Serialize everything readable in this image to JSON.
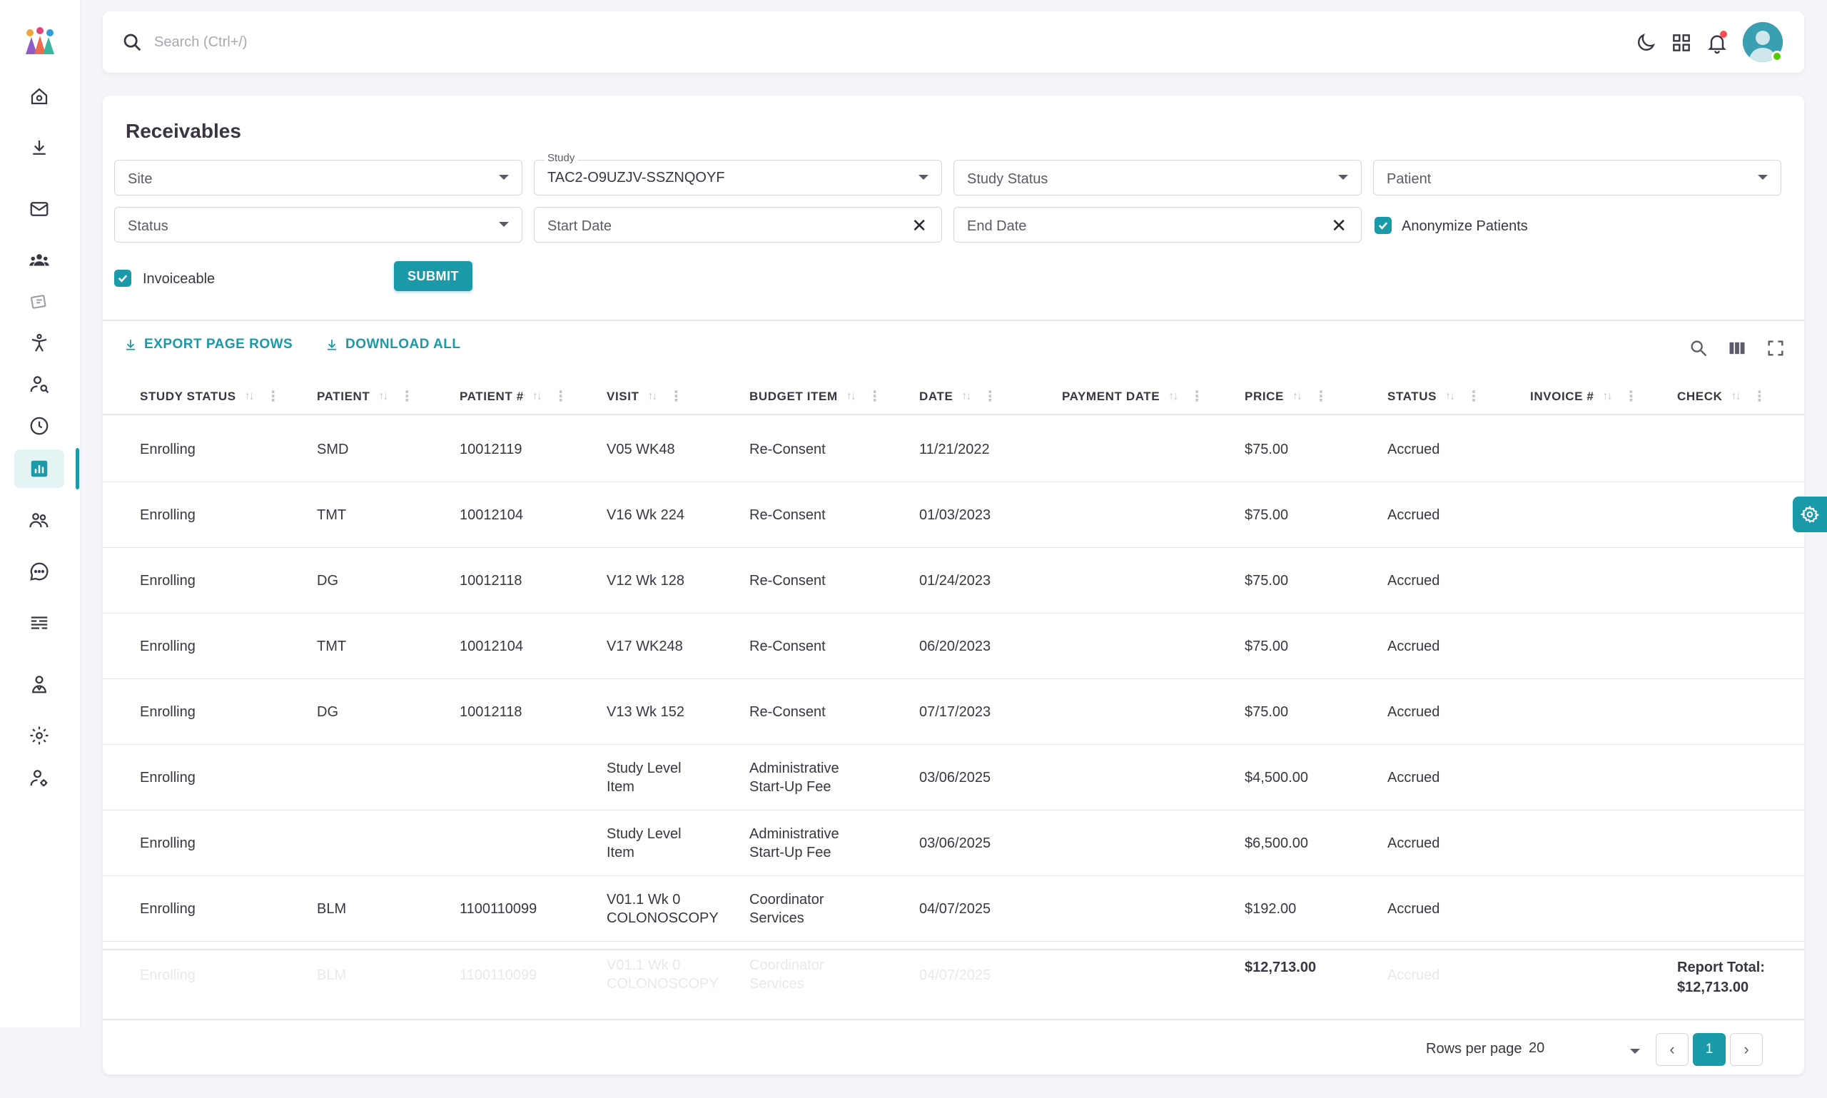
{
  "search": {
    "placeholder": "Search (Ctrl+/)"
  },
  "page": {
    "title": "Receivables"
  },
  "filters": {
    "site": {
      "placeholder": "Site"
    },
    "study": {
      "label": "Study",
      "value": "TAC2-O9UZJV-SSZNQOYF"
    },
    "study_status": {
      "placeholder": "Study Status"
    },
    "patient": {
      "placeholder": "Patient"
    },
    "status": {
      "placeholder": "Status"
    },
    "start_date": {
      "placeholder": "Start Date"
    },
    "end_date": {
      "placeholder": "End Date"
    },
    "anonymize": {
      "label": "Anonymize Patients",
      "checked": true
    },
    "invoiceable": {
      "label": "Invoiceable",
      "checked": true
    },
    "submit_label": "SUBMIT"
  },
  "toolbar": {
    "export_label": "EXPORT PAGE ROWS",
    "download_label": "DOWNLOAD ALL"
  },
  "table": {
    "columns": [
      "STUDY STATUS",
      "PATIENT",
      "PATIENT #",
      "VISIT",
      "BUDGET ITEM",
      "DATE",
      "PAYMENT DATE",
      "PRICE",
      "STATUS",
      "INVOICE #",
      "CHECK"
    ],
    "rows": [
      {
        "study_status": "Enrolling",
        "patient": "SMD",
        "patient_no": "10012119",
        "visit": [
          "V05 WK48"
        ],
        "budget_item": [
          "Re-Consent"
        ],
        "date": "11/21/2022",
        "payment_date": "",
        "price": "$75.00",
        "status": "Accrued",
        "invoice": "",
        "check": ""
      },
      {
        "study_status": "Enrolling",
        "patient": "TMT",
        "patient_no": "10012104",
        "visit": [
          "V16 Wk 224"
        ],
        "budget_item": [
          "Re-Consent"
        ],
        "date": "01/03/2023",
        "payment_date": "",
        "price": "$75.00",
        "status": "Accrued",
        "invoice": "",
        "check": ""
      },
      {
        "study_status": "Enrolling",
        "patient": "DG",
        "patient_no": "10012118",
        "visit": [
          "V12 Wk 128"
        ],
        "budget_item": [
          "Re-Consent"
        ],
        "date": "01/24/2023",
        "payment_date": "",
        "price": "$75.00",
        "status": "Accrued",
        "invoice": "",
        "check": ""
      },
      {
        "study_status": "Enrolling",
        "patient": "TMT",
        "patient_no": "10012104",
        "visit": [
          "V17 WK248"
        ],
        "budget_item": [
          "Re-Consent"
        ],
        "date": "06/20/2023",
        "payment_date": "",
        "price": "$75.00",
        "status": "Accrued",
        "invoice": "",
        "check": ""
      },
      {
        "study_status": "Enrolling",
        "patient": "DG",
        "patient_no": "10012118",
        "visit": [
          "V13 Wk 152"
        ],
        "budget_item": [
          "Re-Consent"
        ],
        "date": "07/17/2023",
        "payment_date": "",
        "price": "$75.00",
        "status": "Accrued",
        "invoice": "",
        "check": ""
      },
      {
        "study_status": "Enrolling",
        "patient": "",
        "patient_no": "",
        "visit": [
          "Study Level",
          "Item"
        ],
        "budget_item": [
          "Administrative",
          "Start-Up Fee"
        ],
        "date": "03/06/2025",
        "payment_date": "",
        "price": "$4,500.00",
        "status": "Accrued",
        "invoice": "",
        "check": ""
      },
      {
        "study_status": "Enrolling",
        "patient": "",
        "patient_no": "",
        "visit": [
          "Study Level",
          "Item"
        ],
        "budget_item": [
          "Administrative",
          "Start-Up Fee"
        ],
        "date": "03/06/2025",
        "payment_date": "",
        "price": "$6,500.00",
        "status": "Accrued",
        "invoice": "",
        "check": ""
      },
      {
        "study_status": "Enrolling",
        "patient": "BLM",
        "patient_no": "1100110099",
        "visit": [
          "V01.1 Wk 0",
          "COLONOSCOPY"
        ],
        "budget_item": [
          "Coordinator",
          "Services"
        ],
        "date": "04/07/2025",
        "payment_date": "",
        "price": "$192.00",
        "status": "Accrued",
        "invoice": "",
        "check": ""
      }
    ],
    "totals": {
      "price_total": "$12,713.00",
      "report_total_label": "Report Total:",
      "report_total_value": "$12,713.00"
    }
  },
  "pagination": {
    "rows_per_page_label": "Rows per page",
    "rows_per_page_value": "20",
    "current_page": "1"
  },
  "colors": {
    "accent": "#1a9aa8",
    "background": "#f4f5fa",
    "notification": "#ff4c51",
    "online": "#56ca00"
  },
  "icons": {
    "sidebar": [
      "home-icon",
      "download-icon",
      "mail-icon",
      "users-group-icon",
      "handshake-icon",
      "person-star-icon",
      "user-search-icon",
      "clock-icon",
      "chart-bar-icon",
      "people-icon",
      "chat-icon",
      "list-icon",
      "doctor-icon",
      "settings-icon",
      "user-cog-icon"
    ]
  }
}
